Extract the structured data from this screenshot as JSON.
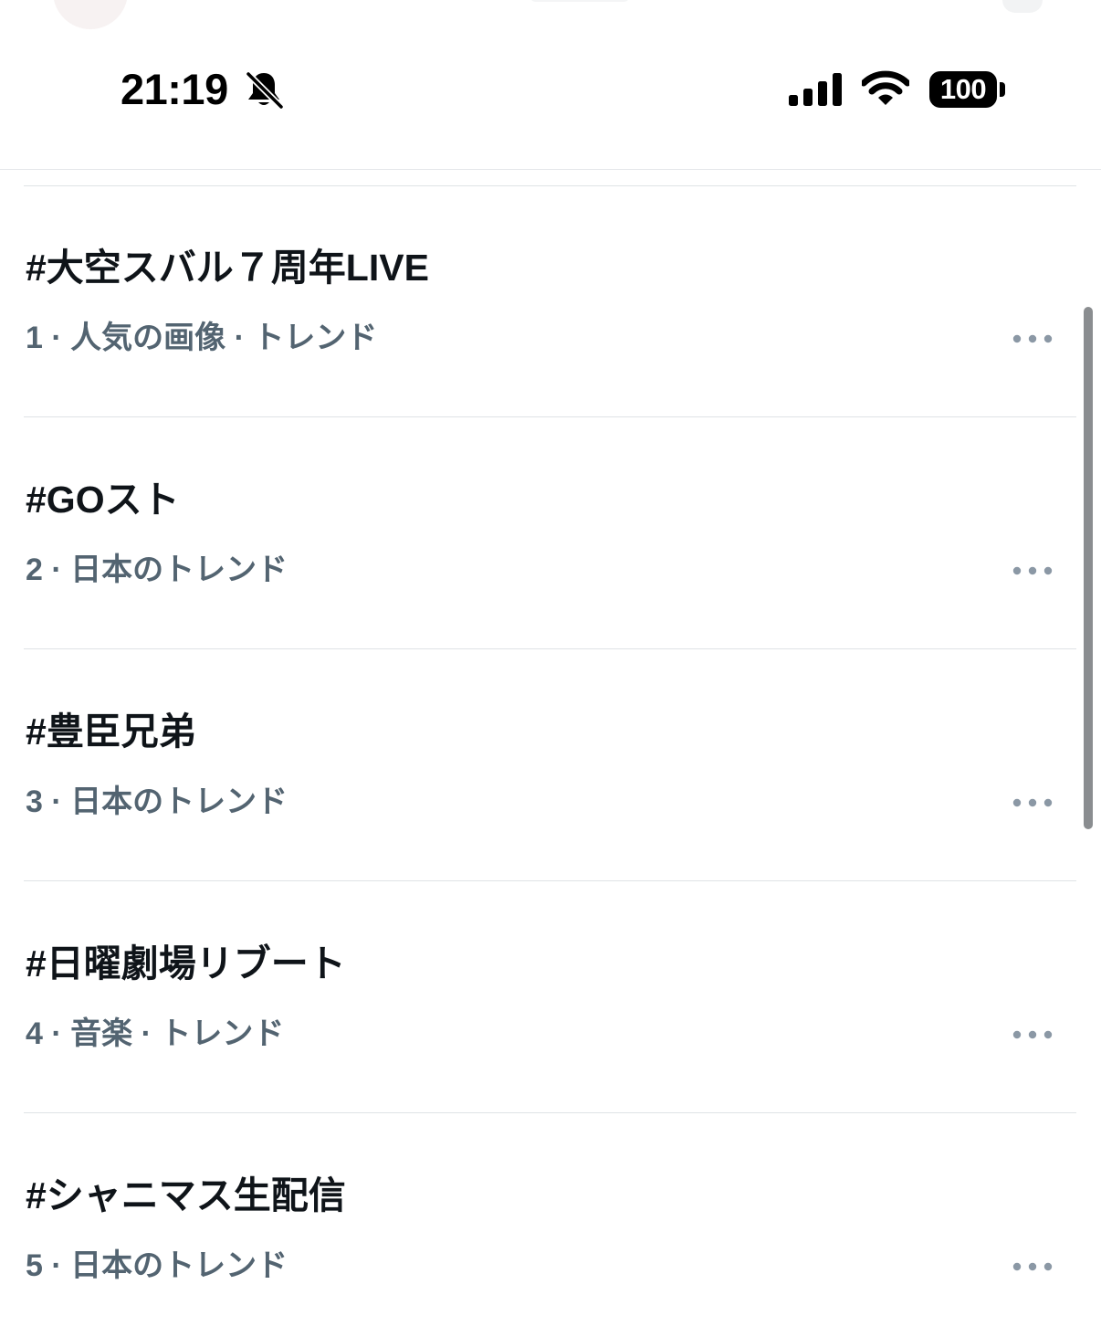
{
  "status_bar": {
    "time": "21:19",
    "battery_level": "100",
    "icons": [
      "bell-slash-icon",
      "cellular-signal-icon",
      "wifi-icon",
      "battery-icon"
    ]
  },
  "trends": [
    {
      "title": "#大空スバル７周年LIVE",
      "meta": "1 · 人気の画像 · トレンド"
    },
    {
      "title": "#GOスト",
      "meta": "2 · 日本のトレンド"
    },
    {
      "title": "#豊臣兄弟",
      "meta": "3 · 日本のトレンド"
    },
    {
      "title": "#日曜劇場リブート",
      "meta": "4 · 音楽 · トレンド"
    },
    {
      "title": "#シャニマス生配信",
      "meta": "5 · 日本のトレンド"
    }
  ],
  "colors": {
    "title_text": "#0f1419",
    "meta_text": "#536471",
    "more_icon": "#8b98a5",
    "divider": "#dfe3e6"
  }
}
